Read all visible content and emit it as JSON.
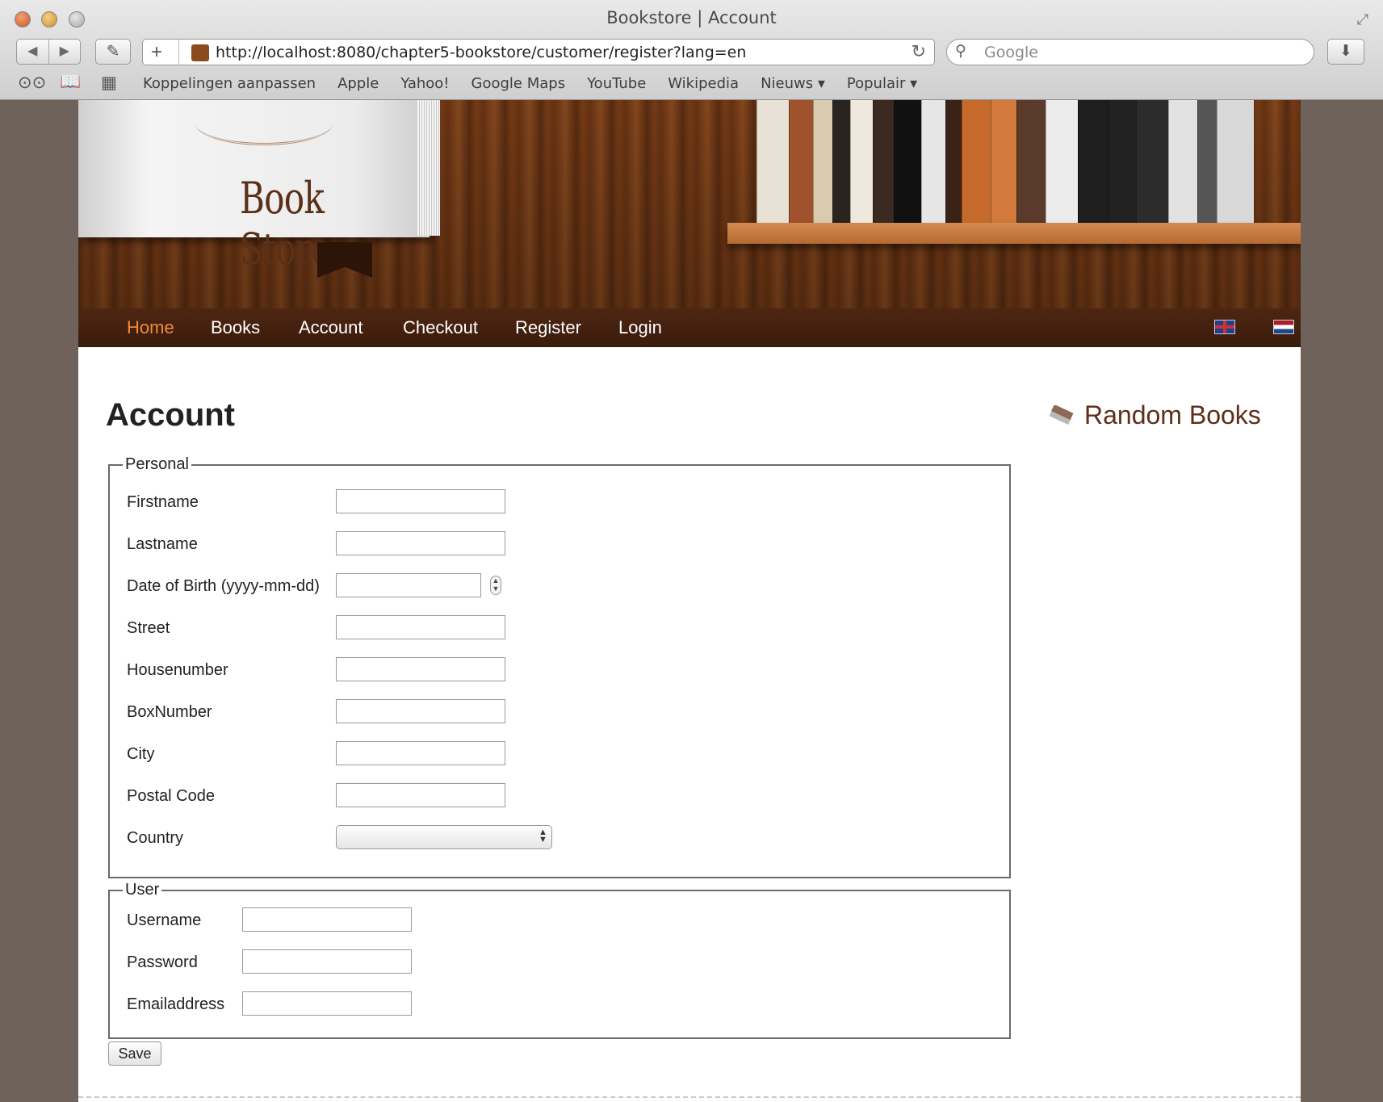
{
  "window": {
    "title": "Bookstore | Account"
  },
  "toolbar": {
    "url": "http://localhost:8080/chapter5-bookstore/customer/register?lang=en",
    "search_placeholder": "Google"
  },
  "bookmarks": [
    "Koppelingen aanpassen",
    "Apple",
    "Yahoo!",
    "Google Maps",
    "YouTube",
    "Wikipedia",
    "Nieuws ▾",
    "Populair ▾"
  ],
  "banner": {
    "brand": "Book Store"
  },
  "nav": {
    "items": [
      "Home",
      "Books",
      "Account",
      "Checkout",
      "Register",
      "Login"
    ],
    "active": "Home",
    "active_color": "#f08a3a"
  },
  "content": {
    "title": "Account",
    "sidebar_title": "Random Books",
    "personal": {
      "legend": "Personal",
      "fields": [
        "Firstname",
        "Lastname",
        "Date of Birth (yyyy-mm-dd)",
        "Street",
        "Housenumber",
        "BoxNumber",
        "City",
        "Postal Code",
        "Country"
      ],
      "country_value": ""
    },
    "user": {
      "legend": "User",
      "fields": [
        "Username",
        "Password",
        "Emailaddress"
      ]
    },
    "save_label": "Save"
  },
  "colors": {
    "brand_brown": "#5c2f18",
    "nav_bg": "#3a1b0c",
    "page_bg": "#6f625a"
  }
}
